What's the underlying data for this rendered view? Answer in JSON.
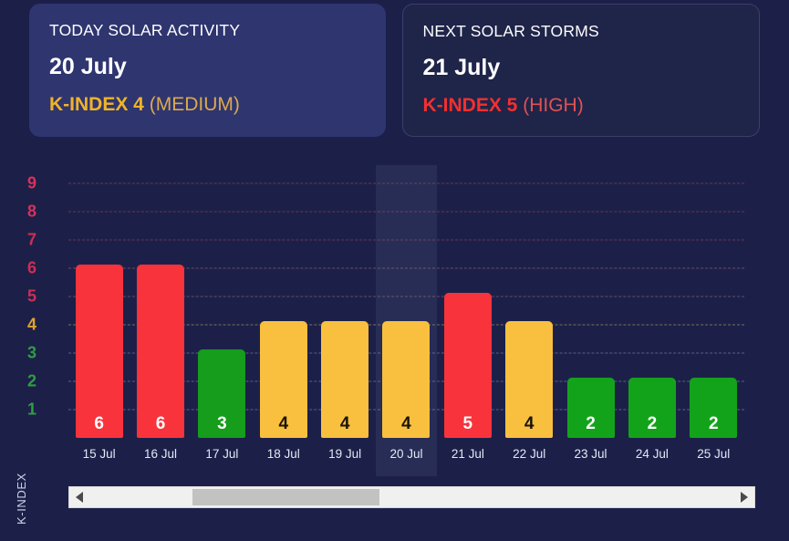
{
  "cards": [
    {
      "title": "TODAY SOLAR ACTIVITY",
      "date": "20 July",
      "k_label": "K-INDEX 4",
      "k_level": "(MEDIUM)",
      "style": "kind-medium",
      "bg": "#2e356f"
    },
    {
      "title": "NEXT SOLAR STORMS",
      "date": "21 July",
      "k_label": "K-INDEX 5",
      "k_level": "(HIGH)",
      "style": "kind-high",
      "bg": "#1f2449"
    }
  ],
  "chart_data": {
    "type": "bar",
    "title": "",
    "xlabel": "",
    "ylabel": "K-INDEX",
    "ylim": [
      0,
      9
    ],
    "grid": true,
    "legend_position": "none",
    "categories": [
      "15 Jul",
      "16 Jul",
      "17 Jul",
      "18 Jul",
      "19 Jul",
      "20 Jul",
      "21 Jul",
      "22 Jul",
      "23 Jul",
      "24 Jul",
      "25 Jul"
    ],
    "values": [
      6,
      6,
      3,
      4,
      4,
      4,
      5,
      4,
      2,
      2,
      2
    ],
    "bar_colors": [
      "#f8333c",
      "#f8333c",
      "#159d1b",
      "#f9bf3f",
      "#f9bf3f",
      "#f9bf3f",
      "#f8333c",
      "#f9bf3f",
      "#13a31a",
      "#13a31a",
      "#13a31a"
    ],
    "label_colors": [
      "#ffffff",
      "#ffffff",
      "#ffffff",
      "#1a1406",
      "#1a1406",
      "#1a1406",
      "#ffffff",
      "#1a1406",
      "#ffffff",
      "#ffffff",
      "#ffffff"
    ],
    "highlighted_category": "20 Jul",
    "yticks": [
      9,
      8,
      7,
      6,
      5,
      4,
      3,
      2,
      1
    ],
    "ytick_colors": [
      "#d8315b",
      "#d8315b",
      "#cc2f55",
      "#cc2f55",
      "#cc2f55",
      "#e2a22c",
      "#2f9e44",
      "#2f9e44",
      "#2f9e44"
    ],
    "gridline_colors": [
      "#6b3550",
      "#6b3550",
      "#6b3550",
      "#6a4a63",
      "#6a4a63",
      "#7d6f56",
      "#565f85",
      "#565f85",
      "#565f85"
    ]
  },
  "scrollbar": {
    "left_arrow": "◀",
    "right_arrow": "▶",
    "thumb_position_pct": 16,
    "thumb_width_pct": 29
  }
}
